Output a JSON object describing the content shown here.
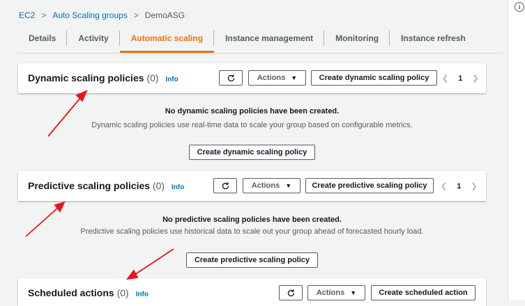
{
  "breadcrumb": {
    "items": [
      "EC2",
      "Auto Scaling groups"
    ],
    "current": "DemoASG",
    "separator": ">"
  },
  "tabs": [
    {
      "label": "Details"
    },
    {
      "label": "Activity"
    },
    {
      "label": "Automatic scaling",
      "active": true
    },
    {
      "label": "Instance management"
    },
    {
      "label": "Monitoring"
    },
    {
      "label": "Instance refresh"
    }
  ],
  "dynamic": {
    "title": "Dynamic scaling policies",
    "count": "(0)",
    "info": "Info",
    "actions_label": "Actions",
    "create_label": "Create dynamic scaling policy",
    "page": "1",
    "empty_title": "No dynamic scaling policies have been created.",
    "empty_desc": "Dynamic scaling policies use real-time data to scale your group based on configurable metrics.",
    "cta_label": "Create dynamic scaling policy"
  },
  "predictive": {
    "title": "Predictive scaling policies",
    "count": "(0)",
    "info": "Info",
    "actions_label": "Actions",
    "create_label": "Create predictive scaling policy",
    "page": "1",
    "empty_title": "No predictive scaling policies have been created.",
    "empty_desc": "Predictive scaling policies use historical data to scale out your group ahead of forecasted hourly load.",
    "cta_label": "Create predictive scaling policy"
  },
  "scheduled": {
    "title": "Scheduled actions",
    "count": "(0)",
    "info": "Info",
    "actions_label": "Actions",
    "create_label": "Create scheduled action"
  },
  "colors": {
    "accent": "#ec7211",
    "link": "#0073bb",
    "annotation": "#e8141b"
  },
  "icons": [
    "refresh-icon",
    "caret-down-icon",
    "chevron-left-icon",
    "chevron-right-icon",
    "info-circle-icon"
  ]
}
